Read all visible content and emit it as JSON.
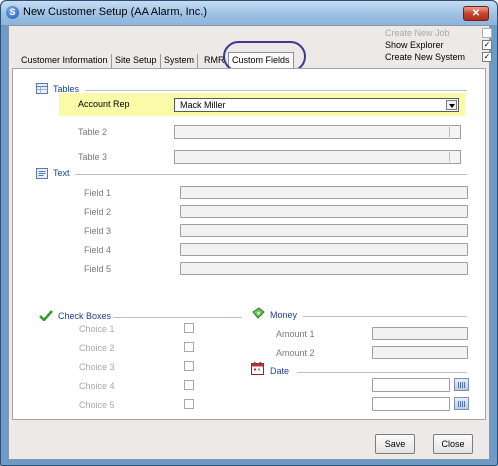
{
  "window": {
    "title": "New Customer Setup (AA Alarm, Inc.)",
    "app_icon": "S",
    "close_glyph": "✕"
  },
  "top_options": [
    {
      "label": "Create New Job",
      "checked": false,
      "enabled": false
    },
    {
      "label": "Show Explorer",
      "checked": true,
      "enabled": true
    },
    {
      "label": "Create New System",
      "checked": true,
      "enabled": true
    }
  ],
  "tabs": [
    {
      "label": "Customer Information"
    },
    {
      "label": "Site Setup"
    },
    {
      "label": "System"
    },
    {
      "label": "RMR"
    },
    {
      "label": "Custom Fields",
      "active": true
    }
  ],
  "sections": {
    "tables": {
      "title": "Tables",
      "icon": "table-icon"
    },
    "text": {
      "title": "Text",
      "icon": "text-icon"
    },
    "check_boxes": {
      "title": "Check Boxes",
      "icon": "checkmark-icon"
    },
    "money": {
      "title": "Money",
      "icon": "money-icon"
    },
    "date": {
      "title": "Date",
      "icon": "calendar-icon"
    }
  },
  "tables": [
    {
      "label": "Account Rep",
      "value": "Mack Miller"
    },
    {
      "label": "Table 2",
      "value": ""
    },
    {
      "label": "Table 3",
      "value": ""
    }
  ],
  "text_fields": [
    {
      "label": "Field 1"
    },
    {
      "label": "Field 2"
    },
    {
      "label": "Field 3"
    },
    {
      "label": "Field 4"
    },
    {
      "label": "Field 5"
    }
  ],
  "choices": [
    {
      "label": "Choice 1",
      "checked": false
    },
    {
      "label": "Choice 2",
      "checked": false
    },
    {
      "label": "Choice 3",
      "checked": false
    },
    {
      "label": "Choice 4",
      "checked": false
    },
    {
      "label": "Choice 5",
      "checked": false
    }
  ],
  "money": [
    {
      "label": "Amount 1"
    },
    {
      "label": "Amount 2"
    }
  ],
  "buttons": {
    "save": "Save",
    "close": "Close"
  },
  "colors": {
    "accent": "#1c3f9e",
    "highlight": "#fafaa8",
    "tab_circle": "#3b3a8f"
  }
}
